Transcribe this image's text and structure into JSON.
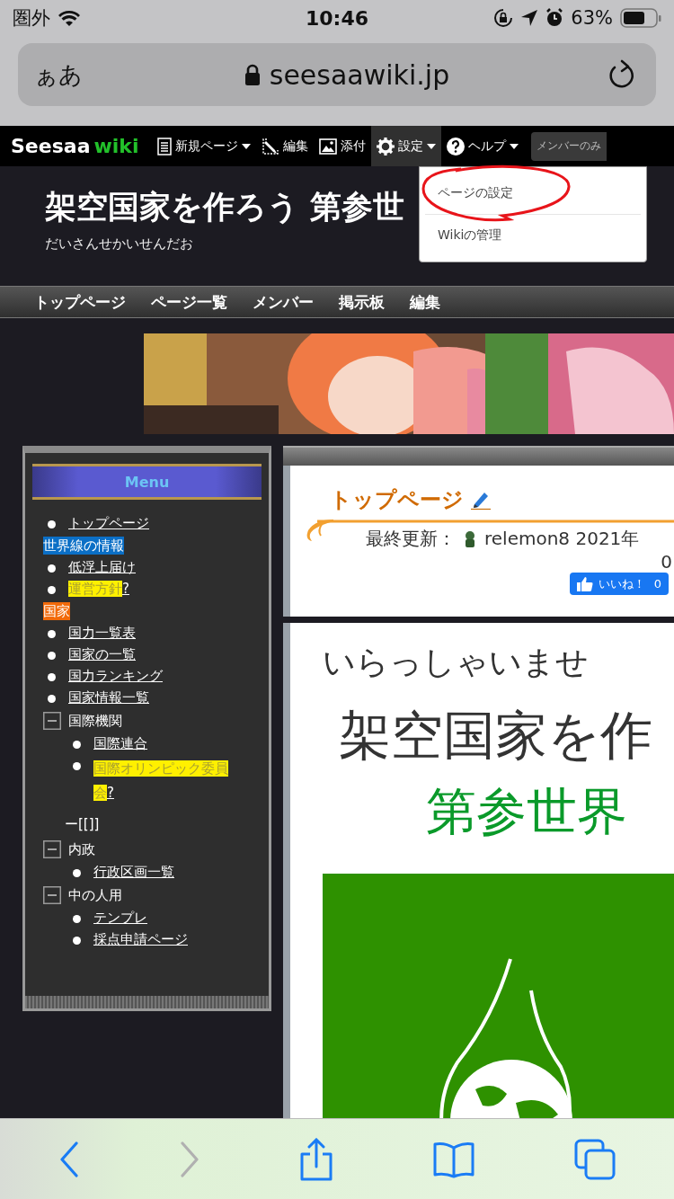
{
  "status_bar": {
    "carrier": "圏外",
    "time": "10:46",
    "battery": "63%"
  },
  "address_bar": {
    "text_size_button": "ぁあ",
    "url": "seesaawiki.jp"
  },
  "wiki_toolbar": {
    "logo": {
      "name": "Seesaa",
      "suffix": "wiki"
    },
    "items": [
      {
        "kind": "new",
        "label": "新規ページ",
        "dropdown": true,
        "selected": false
      },
      {
        "kind": "edit",
        "label": "編集",
        "dropdown": false,
        "selected": false
      },
      {
        "kind": "attach",
        "label": "添付",
        "dropdown": false,
        "selected": false
      },
      {
        "kind": "settings",
        "label": "設定",
        "dropdown": true,
        "selected": true
      },
      {
        "kind": "help",
        "label": "ヘルプ",
        "dropdown": true,
        "selected": false
      }
    ],
    "member_button": "メンバーのみ"
  },
  "settings_menu": {
    "items": [
      {
        "label": "ページの設定",
        "circled": true
      },
      {
        "label": "Wikiの管理",
        "circled": false
      }
    ]
  },
  "header": {
    "title": "架空国家を作ろう 第参世",
    "subtitle": "だいさんせかいせんだお"
  },
  "nav": [
    "トップページ",
    "ページ一覧",
    "メンバー",
    "掲示板",
    "編集"
  ],
  "menu": {
    "title": "Menu",
    "items": [
      {
        "kind": "link",
        "text": "トップページ"
      },
      {
        "kind": "heading",
        "text": "世界線の情報",
        "color": "#0b6fc6"
      },
      {
        "kind": "link",
        "text": "低浮上届け"
      },
      {
        "kind": "missing",
        "text": "運営方針",
        "suffix": "?"
      },
      {
        "kind": "heading",
        "text": "国家",
        "color": "#f26a0a"
      },
      {
        "kind": "link",
        "text": "国力一覧表"
      },
      {
        "kind": "link",
        "text": "国家の一覧"
      },
      {
        "kind": "link",
        "text": "国力ランキング"
      },
      {
        "kind": "link",
        "text": "国家情報一覧"
      },
      {
        "kind": "folder",
        "text": "国際機関",
        "expanded": true,
        "children": [
          {
            "kind": "link",
            "text": "国際連合"
          },
          {
            "kind": "missing",
            "text": "国際オリンピック委員会",
            "suffix": "?"
          },
          {
            "kind": "plain",
            "text": "ー[[]]"
          }
        ]
      },
      {
        "kind": "folder",
        "text": "内政",
        "expanded": true,
        "children": [
          {
            "kind": "link",
            "text": "行政区画一覧"
          }
        ]
      },
      {
        "kind": "folder",
        "text": "中の人用",
        "expanded": true,
        "children": [
          {
            "kind": "link",
            "text": "テンプレ"
          },
          {
            "kind": "link",
            "text": "採点申請ページ"
          }
        ]
      }
    ]
  },
  "page": {
    "title": "トップページ",
    "updated_label": "最終更新：",
    "updated_by": "relemon8 2021年",
    "updated_rest": "0",
    "like": {
      "label": "いいね！",
      "count": "0"
    },
    "welcome": "いらっしゃいませ",
    "heading": "架空国家を作",
    "subheading": "第参世界"
  },
  "safari_toolbar": {
    "back_disabled": false,
    "forward_disabled": true
  }
}
